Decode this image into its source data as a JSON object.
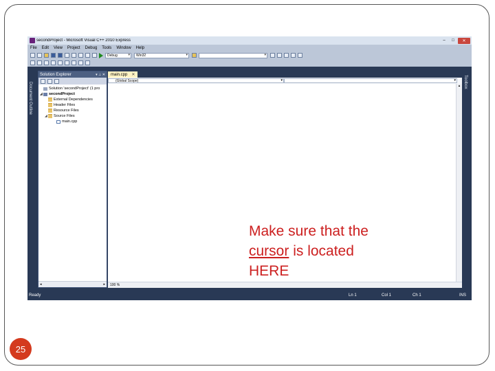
{
  "slide": {
    "page_number": "25"
  },
  "window": {
    "title": "secondProject - Microsoft Visual C++ 2010 Express",
    "controls": {
      "minimize": "–",
      "maximize": "□",
      "close": "✕"
    }
  },
  "menu": [
    "File",
    "Edit",
    "View",
    "Project",
    "Debug",
    "Tools",
    "Window",
    "Help"
  ],
  "toolbar": {
    "config": "Debug",
    "platform": "Win32"
  },
  "solution_explorer": {
    "title": "Solution Explorer",
    "pin": "▾ ⊥ ✕",
    "tree": [
      {
        "label": "Solution 'secondProject' (1 pro",
        "icon": "solution-icon"
      },
      {
        "label": "secondProject",
        "icon": "project-icon"
      },
      {
        "label": "External Dependencies",
        "icon": "folder-icon"
      },
      {
        "label": "Header Files",
        "icon": "folder-icon"
      },
      {
        "label": "Resource Files",
        "icon": "folder-icon"
      },
      {
        "label": "Source Files",
        "icon": "folder-icon"
      },
      {
        "label": "main.cpp",
        "icon": "file-icon"
      }
    ]
  },
  "side_tabs": {
    "left": "Document Outline",
    "right": "Toolbox"
  },
  "editor": {
    "tab": "main.cpp",
    "scope": "(Global Scope)",
    "zoom": "100 %"
  },
  "status": {
    "ready": "Ready",
    "ln": "Ln 1",
    "col": "Col 1",
    "ch": "Ch 1",
    "ins": "INS"
  },
  "annotation": {
    "line1": "Make sure that the",
    "line2_underlined": "cursor",
    "line2_rest": " is located",
    "line3": "HERE"
  },
  "colors": {
    "ide_frame": "#293955",
    "annotation": "#cc1f1f",
    "page_badge": "#d43a1e"
  }
}
